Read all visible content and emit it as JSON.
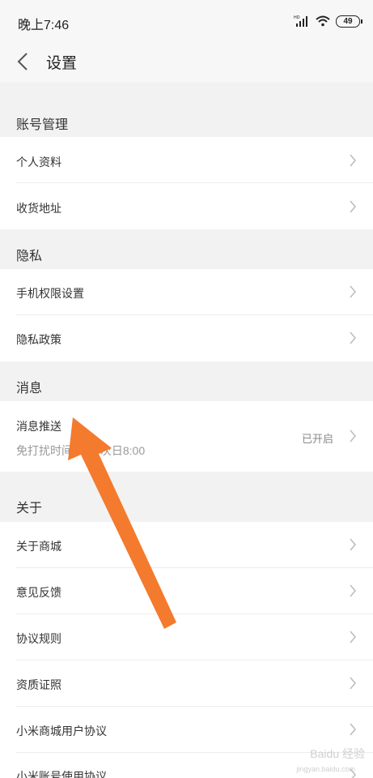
{
  "status_bar": {
    "time": "晚上7:46",
    "battery": "49",
    "network_badge": "HD"
  },
  "header": {
    "title": "设置"
  },
  "sections": {
    "account": {
      "title": "账号管理",
      "items": [
        {
          "label": "个人资料"
        },
        {
          "label": "收货地址"
        }
      ]
    },
    "privacy": {
      "title": "隐私",
      "items": [
        {
          "label": "手机权限设置"
        },
        {
          "label": "隐私政策"
        }
      ]
    },
    "messages": {
      "title": "消息",
      "items": [
        {
          "label": "消息推送",
          "sub": "免打扰时间 …0~次日8:00",
          "value": "已开启"
        }
      ]
    },
    "about": {
      "title": "关于",
      "items": [
        {
          "label": "关于商城"
        },
        {
          "label": "意见反馈"
        },
        {
          "label": "协议规则"
        },
        {
          "label": "资质证照"
        },
        {
          "label": "小米商城用户协议"
        },
        {
          "label": "小米账号使用协议"
        }
      ]
    }
  },
  "watermark": {
    "text": "Baidu 经验",
    "sub": "jingyan.baidu.com"
  },
  "colors": {
    "arrow": "#f47a2e",
    "background": "#f2f2f2",
    "row": "#ffffff"
  }
}
